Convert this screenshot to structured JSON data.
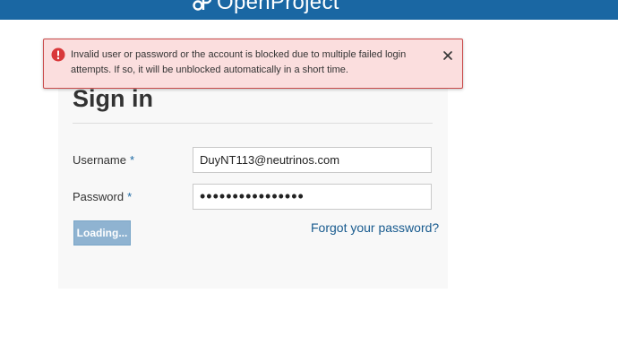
{
  "header": {
    "brand_name": "OpenProject",
    "background_color": "#1a67a3"
  },
  "alert": {
    "message": "Invalid user or password or the account is blocked due to multiple failed login attempts. If so, it will be unblocked automatically in a short time.",
    "icon": "error-circle-icon",
    "close_icon": "close-icon",
    "accent_color": "#d9383a"
  },
  "login": {
    "title": "Sign in",
    "username_label": "Username",
    "username_value": "DuyNT113@neutrinos.com",
    "password_label": "Password",
    "password_value": "pwdpwdpwdpwdpwdp",
    "required_marker": "*",
    "submit_label": "Loading...",
    "forgot_link": "Forgot your password?"
  }
}
